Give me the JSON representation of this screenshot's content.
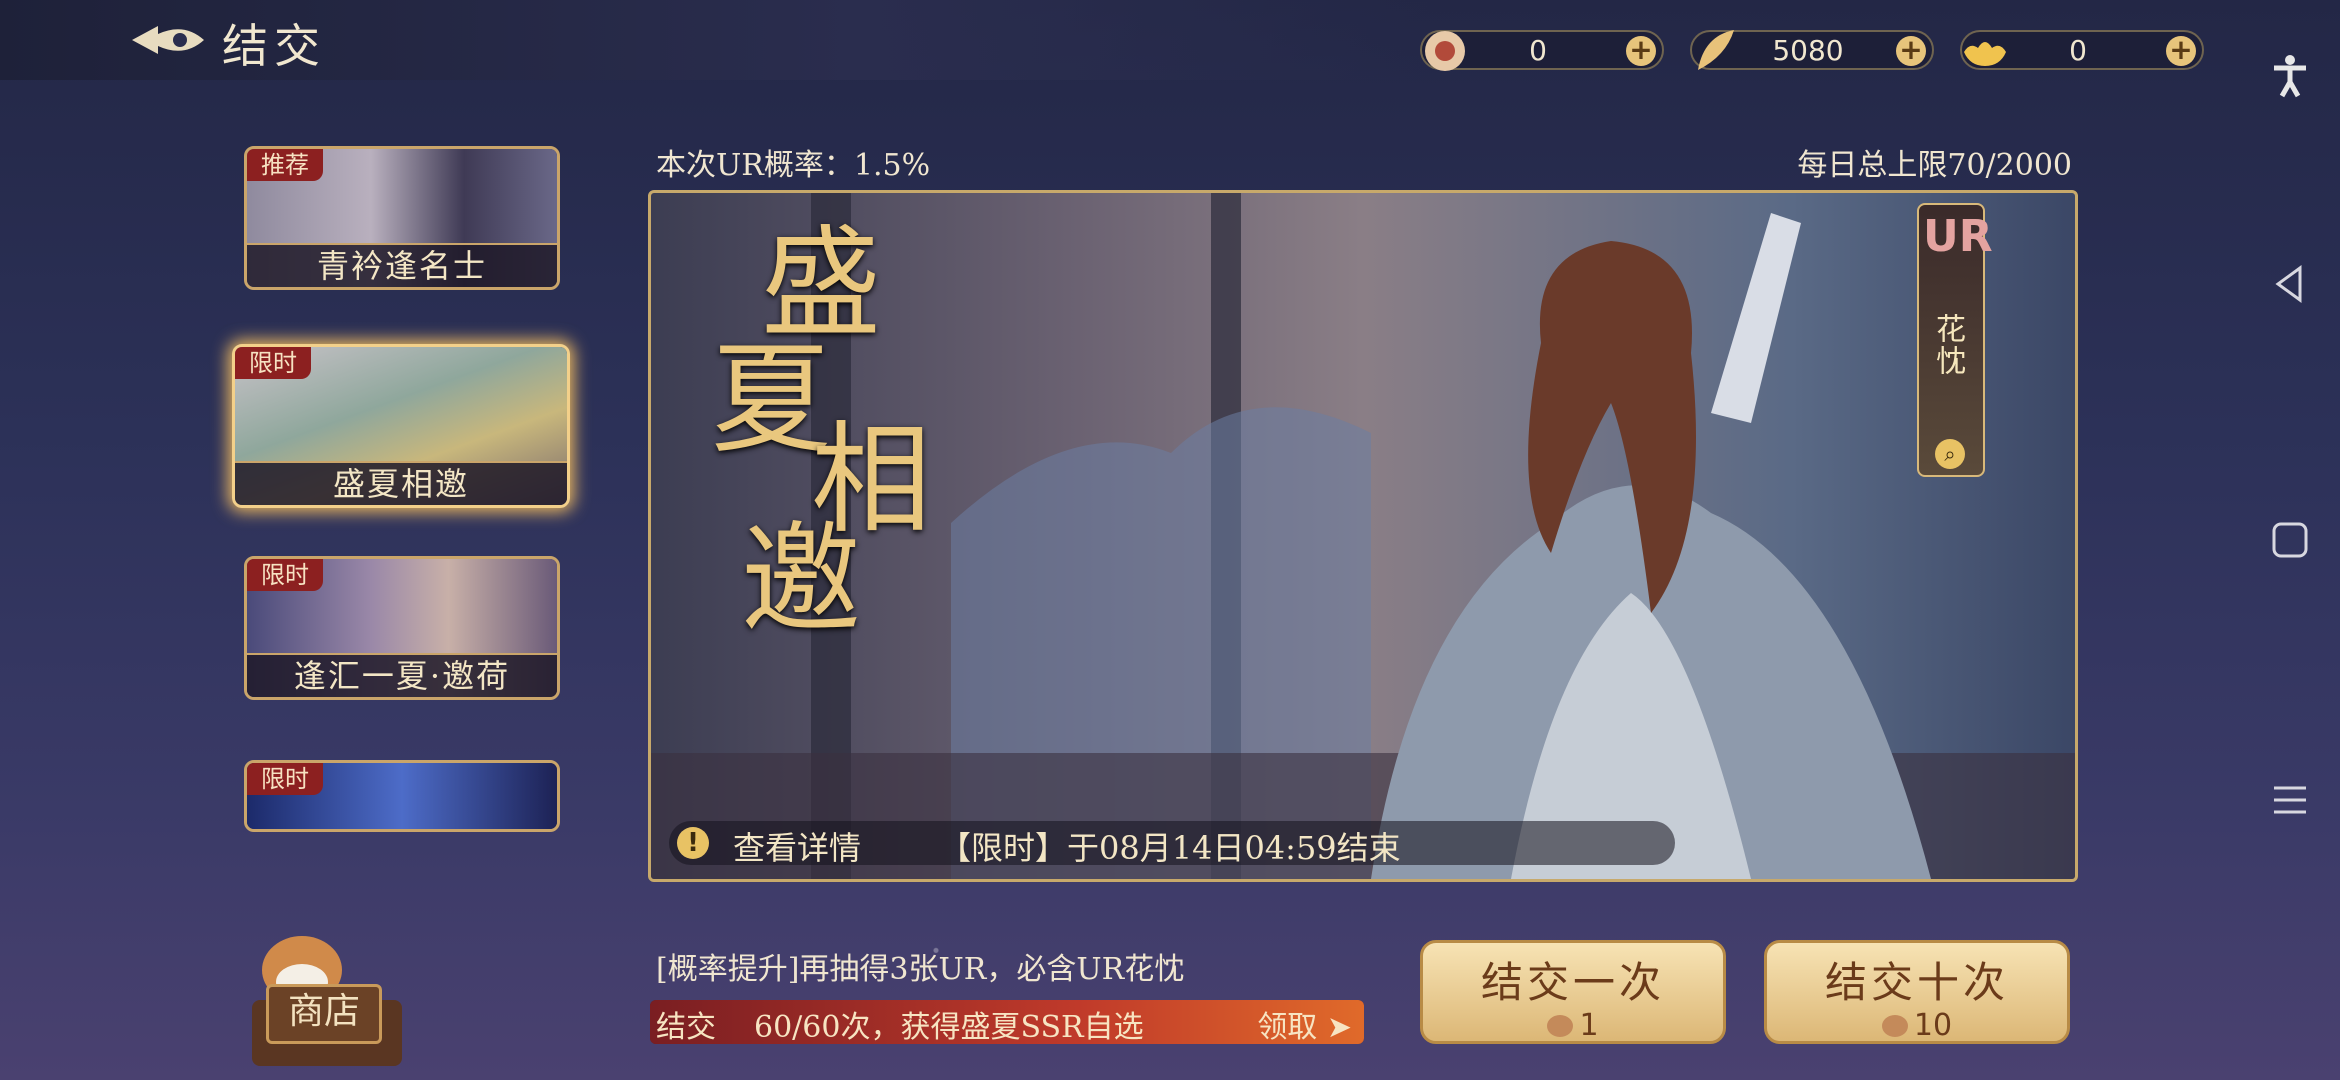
{
  "header": {
    "title": "结交"
  },
  "currencies": [
    {
      "name": "ticket",
      "value": "0",
      "icon": "wish-ticket-icon"
    },
    {
      "name": "feather",
      "value": "5080",
      "icon": "feather-icon"
    },
    {
      "name": "gold",
      "value": "0",
      "icon": "gold-ingot-icon"
    }
  ],
  "tabs": [
    {
      "badge": "推荐",
      "label": "青衿逢名士"
    },
    {
      "badge": "限时",
      "label": "盛夏相邀"
    },
    {
      "badge": "限时",
      "label": "逢汇一夏·邀荷"
    },
    {
      "badge": "限时",
      "label": ""
    }
  ],
  "banner": {
    "prob_text": "本次UR概率：1.5%",
    "daily_limit": "每日总上限70/2000",
    "title_chars": [
      "盛",
      "夏",
      "相",
      "邀"
    ],
    "ur_badge": "UR",
    "ur_name": "花忱",
    "details_label": "查看详情",
    "timed_text": "【限时】于08月14日04:59结束"
  },
  "footer": {
    "boost_text": "[概率提升]再抽得3张UR，必含UR花忱",
    "progress_prefix": "结交",
    "progress_text": "60/60次，获得盛夏SSR自选",
    "progress_fraction": 1.0,
    "claim_label": "领取",
    "shop_label": "商店",
    "btn_once": "结交一次",
    "btn_once_cost": "1",
    "btn_ten": "结交十次",
    "btn_ten_cost": "10"
  },
  "colors": {
    "accent_gold": "#caa56a",
    "bg": "#2c3158",
    "badge_red": "#8c2020"
  }
}
